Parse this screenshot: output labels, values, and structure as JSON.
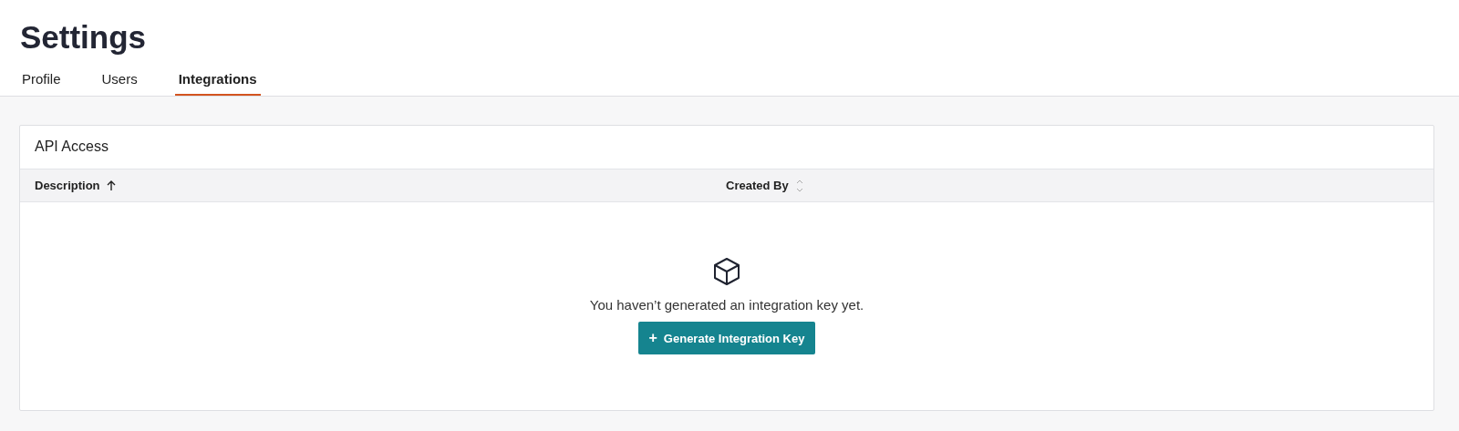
{
  "page": {
    "title": "Settings"
  },
  "tabs": [
    {
      "label": "Profile",
      "selected": false
    },
    {
      "label": "Users",
      "selected": false
    },
    {
      "label": "Integrations",
      "selected": true
    }
  ],
  "panel": {
    "title": "API Access",
    "table": {
      "columns": [
        {
          "label": "Description",
          "sorted": true
        },
        {
          "label": "Created By",
          "sorted": false
        }
      ]
    },
    "empty_state": {
      "message": "You haven’t generated an integration key yet.",
      "button": {
        "icon": "+",
        "label": "Generate Integration Key"
      }
    }
  }
}
